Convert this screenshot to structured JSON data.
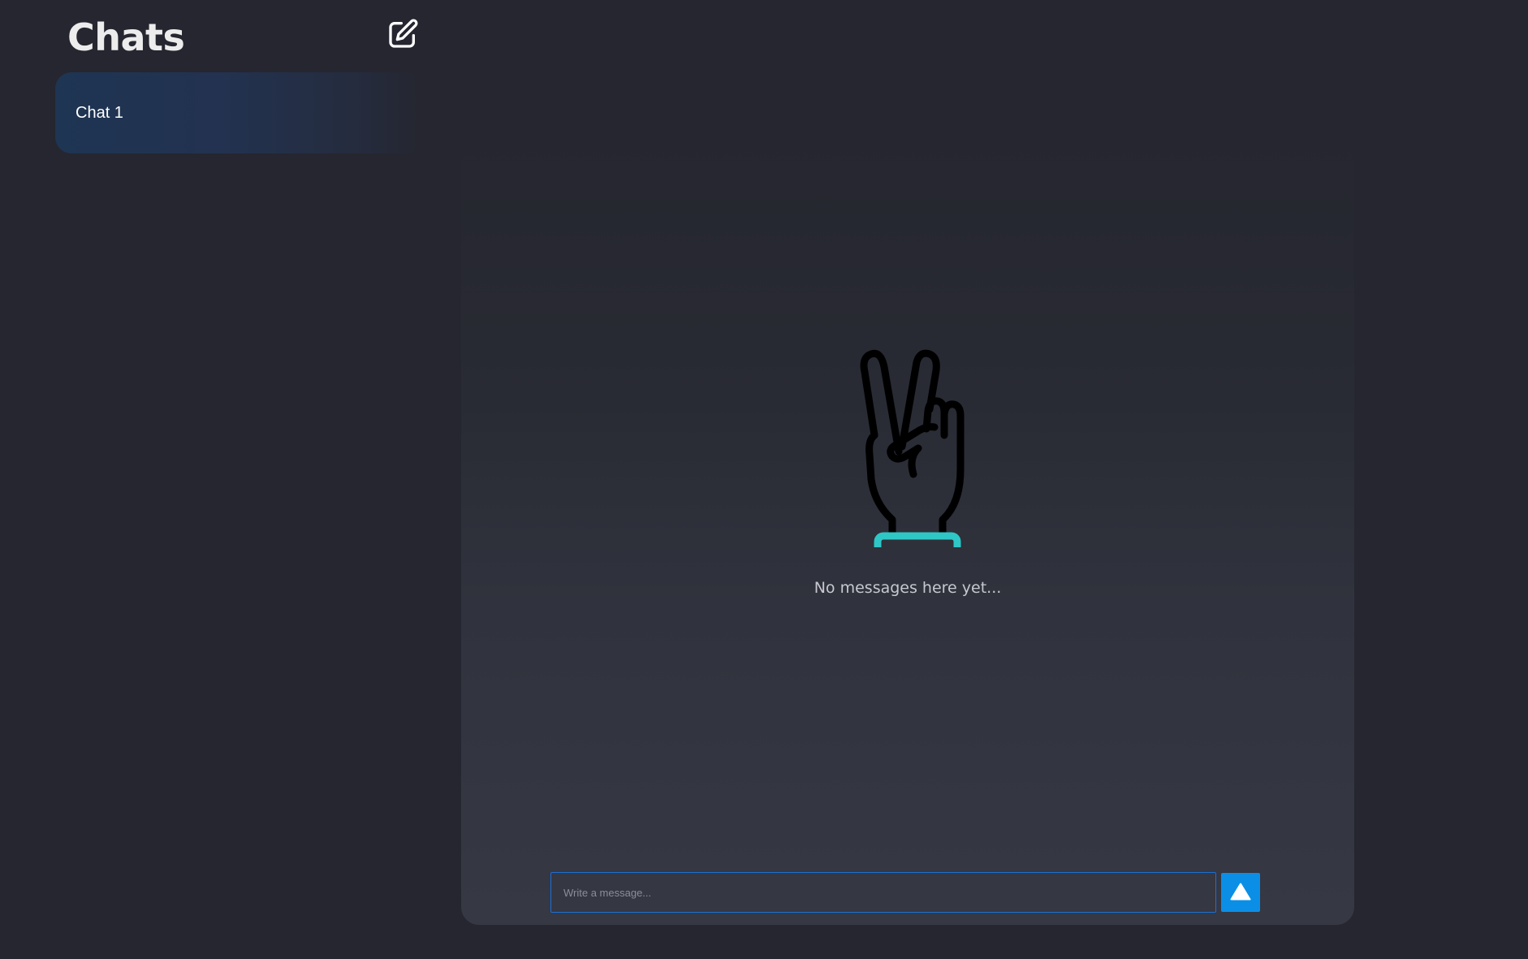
{
  "sidebar": {
    "title": "Chats",
    "new_chat_icon": "edit-square-icon",
    "chats": [
      {
        "label": "Chat 1"
      }
    ]
  },
  "main": {
    "empty_state": {
      "icon": "peace-hand-icon",
      "text": "No messages here yet..."
    },
    "composer": {
      "placeholder": "Write a message...",
      "value": "",
      "send_icon": "triangle-up-icon"
    }
  },
  "colors": {
    "background": "#25262f",
    "chat_item_accent": "#1e3553",
    "input_border": "#1d6fd6",
    "send_button": "#0b8fe6",
    "icon_accent": "#2fc6c6"
  }
}
